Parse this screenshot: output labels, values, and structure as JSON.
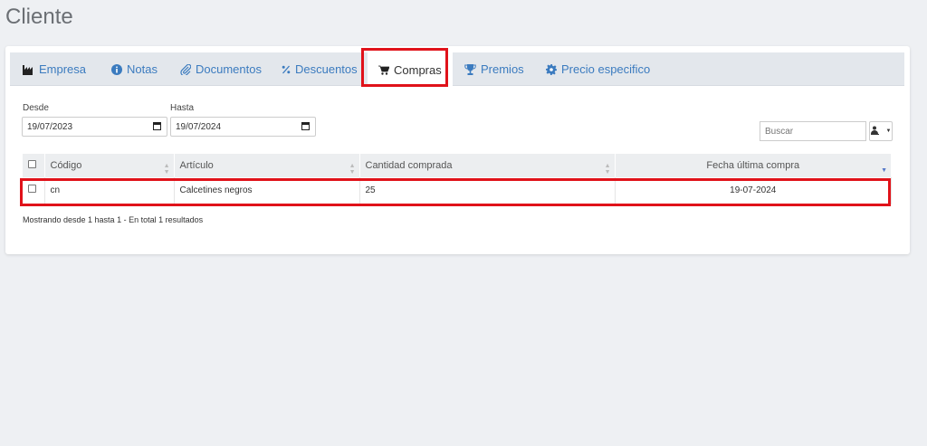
{
  "page": {
    "title": "Cliente"
  },
  "tabs": [
    {
      "label": "Empresa",
      "icon": "industry-icon"
    },
    {
      "label": "Notas",
      "icon": "info-circle-icon"
    },
    {
      "label": "Documentos",
      "icon": "paperclip-icon"
    },
    {
      "label": "Descuentos",
      "icon": "percent-icon"
    },
    {
      "label": "Compras",
      "icon": "shopping-cart-icon",
      "active": true
    },
    {
      "label": "Premios",
      "icon": "trophy-icon"
    },
    {
      "label": "Precio especifico",
      "icon": "gear-icon"
    }
  ],
  "filters": {
    "desde_label": "Desde",
    "desde_value": "19/07/2023",
    "hasta_label": "Hasta",
    "hasta_value": "19/07/2024"
  },
  "search": {
    "placeholder": "Buscar"
  },
  "table": {
    "columns": [
      "Código",
      "Artículo",
      "Cantidad comprada",
      "Fecha última compra"
    ],
    "sorted_column": "Fecha última compra",
    "rows": [
      {
        "codigo": "cn",
        "articulo": "Calcetines negros",
        "cantidad": "25",
        "fecha": "19-07-2024"
      }
    ]
  },
  "footer": {
    "info": "Mostrando desde 1 hasta 1 - En total 1 resultados"
  },
  "colors": {
    "accent": "#3b7bbf",
    "highlight": "#e0121a",
    "background": "#eef0f3"
  }
}
